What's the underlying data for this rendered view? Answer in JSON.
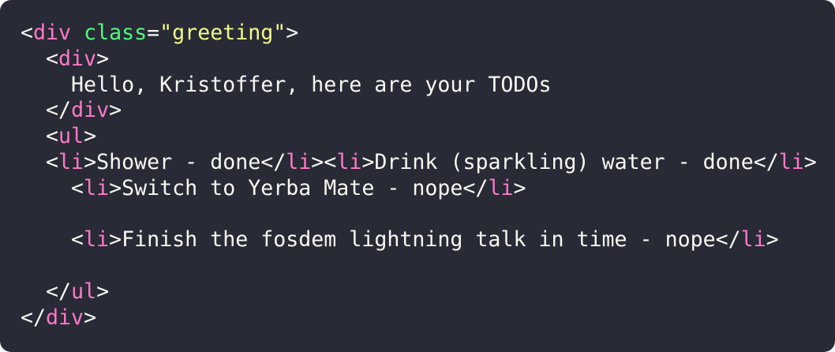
{
  "colors": {
    "background": "#282a36",
    "text": "#f8f8f2",
    "tag": "#ff79c6",
    "attribute": "#50fa7b",
    "string": "#f1fa8c"
  },
  "code": {
    "tag_div": "div",
    "tag_ul": "ul",
    "tag_li": "li",
    "attr_class": "class",
    "attr_value": "\"greeting\"",
    "greeting_text": "Hello, Kristoffer, here are your TODOs",
    "todos": [
      "Shower - done",
      "Drink (sparkling) water - done",
      "Switch to Yerba Mate - nope",
      "Finish the fosdem lightning talk in time - nope"
    ]
  }
}
